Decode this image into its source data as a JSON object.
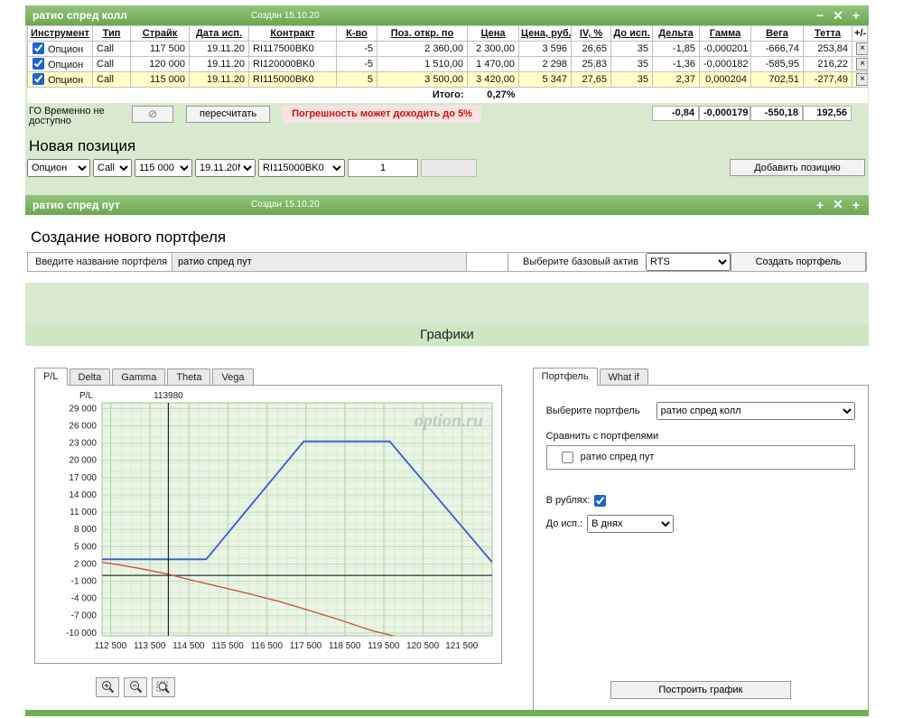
{
  "ui": {
    "delete_icon": "×",
    "go_icon": "⊘"
  },
  "panel_call": {
    "title": "ратио спред колл",
    "created": "Создан 15.10.20",
    "btn_minimize": "−",
    "btn_close": "✕",
    "btn_add": "+",
    "table": {
      "headers": [
        "Инструмент",
        "Тип",
        "Страйк",
        "Дата исп.",
        "Контракт",
        "К-во",
        "Поз. откр. по",
        "Цена",
        "Цена, руб.",
        "IV, %",
        "До исп.",
        "Дельта",
        "Гамма",
        "Вега",
        "Тетта",
        "+/-"
      ],
      "rows": [
        {
          "instrument": "Опцион",
          "type": "Call",
          "strike": "117 500",
          "exp_date": "19.11.20",
          "contract": "RI117500BK0",
          "qty": "-5",
          "open_at": "2 360,00",
          "price": "2 300,00",
          "price_rub": "3 596",
          "iv": "26,65",
          "days": "35",
          "delta": "-1,85",
          "gamma": "-0,000201",
          "vega": "-666,74",
          "theta": "253,84"
        },
        {
          "instrument": "Опцион",
          "type": "Call",
          "strike": "120 000",
          "exp_date": "19.11.20",
          "contract": "RI120000BK0",
          "qty": "-5",
          "open_at": "1 510,00",
          "price": "1 470,00",
          "price_rub": "2 298",
          "iv": "25,83",
          "days": "35",
          "delta": "-1,36",
          "gamma": "-0,000182",
          "vega": "-585,95",
          "theta": "216,22"
        },
        {
          "instrument": "Опцион",
          "type": "Call",
          "strike": "115 000",
          "exp_date": "19.11.20",
          "contract": "RI115000BK0",
          "qty": "5",
          "open_at": "3 500,00",
          "price": "3 420,00",
          "price_rub": "5 347",
          "iv": "27,65",
          "days": "35",
          "delta": "2,37",
          "gamma": "0,000204",
          "vega": "702,51",
          "theta": "-277,49"
        }
      ],
      "total_label": "Итого:",
      "total_pct": "0,27%",
      "totals": {
        "delta": "-0,84",
        "gamma": "-0,000179",
        "vega": "-550,18",
        "theta": "192,56"
      }
    },
    "go_label": "ГО Временно не доступно",
    "recalc_label": "пересчитать",
    "accuracy_note": "Погрешность может доходить до 5%",
    "new_position": {
      "title": "Новая позиция",
      "instrument": "Опцион",
      "type": "Call",
      "strike": "115 000",
      "exp_date": "19.11.20M",
      "contract": "RI115000BK0",
      "qty": "1",
      "add_label": "Добавить позицию"
    }
  },
  "panel_put": {
    "title": "ратио спред пут",
    "created": "Создан 15.10.20",
    "btn_expand": "+",
    "btn_close": "✕",
    "btn_add": "+"
  },
  "new_portfolio": {
    "title": "Создание нового портфеля",
    "name_label": "Введите название портфеля",
    "name_value": "ратио спред пут",
    "asset_label": "Выберите базовый актив",
    "asset_value": "RTS",
    "create_label": "Создать портфель"
  },
  "charts_section": {
    "title": "Графики",
    "chart_tabs": [
      "P/L",
      "Delta",
      "Gamma",
      "Theta",
      "Vega"
    ],
    "active_chart_tab": "P/L"
  },
  "chart_data": {
    "type": "line",
    "ylabel": "P/L",
    "grid": true,
    "xlim": [
      112280,
      122280
    ],
    "ylim": [
      -10500,
      30000
    ],
    "xticks": [
      112500,
      113500,
      114500,
      115500,
      116500,
      117500,
      118500,
      119500,
      120500,
      121500
    ],
    "xtick_labels": [
      "112 500",
      "113 500",
      "114 500",
      "115 500",
      "116 500",
      "117 500",
      "118 500",
      "119 500",
      "120 500",
      "121 500"
    ],
    "yticks": [
      29000,
      26000,
      23000,
      20000,
      17000,
      14000,
      11000,
      8000,
      5000,
      2000,
      -1000,
      -4000,
      -7000,
      -10000
    ],
    "ytick_labels": [
      "29 000",
      "26 000",
      "23 000",
      "20 000",
      "17 000",
      "14 000",
      "11 000",
      "8 000",
      "5 000",
      "2 000",
      "-1 000",
      "-4 000",
      "-7 000",
      "-10 000"
    ],
    "marker": {
      "x": 113980,
      "label": "113980"
    },
    "watermark": "option.ru",
    "series": [
      {
        "name": "expiration-line",
        "color": "#3b5bd6",
        "x": [
          112280,
          114950,
          117450,
          119650,
          122280
        ],
        "y": [
          2800,
          2800,
          23300,
          23300,
          2300
        ]
      },
      {
        "name": "current-line",
        "color": "#d1493b",
        "x": [
          112280,
          112800,
          113400,
          113980,
          114500,
          115200,
          116000,
          116800,
          117600,
          118400,
          119200,
          119800
        ],
        "y": [
          2300,
          1750,
          1000,
          200,
          -700,
          -1800,
          -3100,
          -4500,
          -6100,
          -7800,
          -9600,
          -10600
        ]
      }
    ]
  },
  "right_panel": {
    "tabs": [
      "Портфель",
      "What if"
    ],
    "active_tab": "Портфель",
    "select_portfolio_label": "Выберите портфель",
    "selected_portfolio": "ратио спред колл",
    "compare_label": "Сравнить с портфелями",
    "compare_option": "ратио спред пут",
    "rubles_label": "В рублях:",
    "days_label": "До исп.:",
    "days_value": "В днях",
    "build_label": "Построить график"
  }
}
